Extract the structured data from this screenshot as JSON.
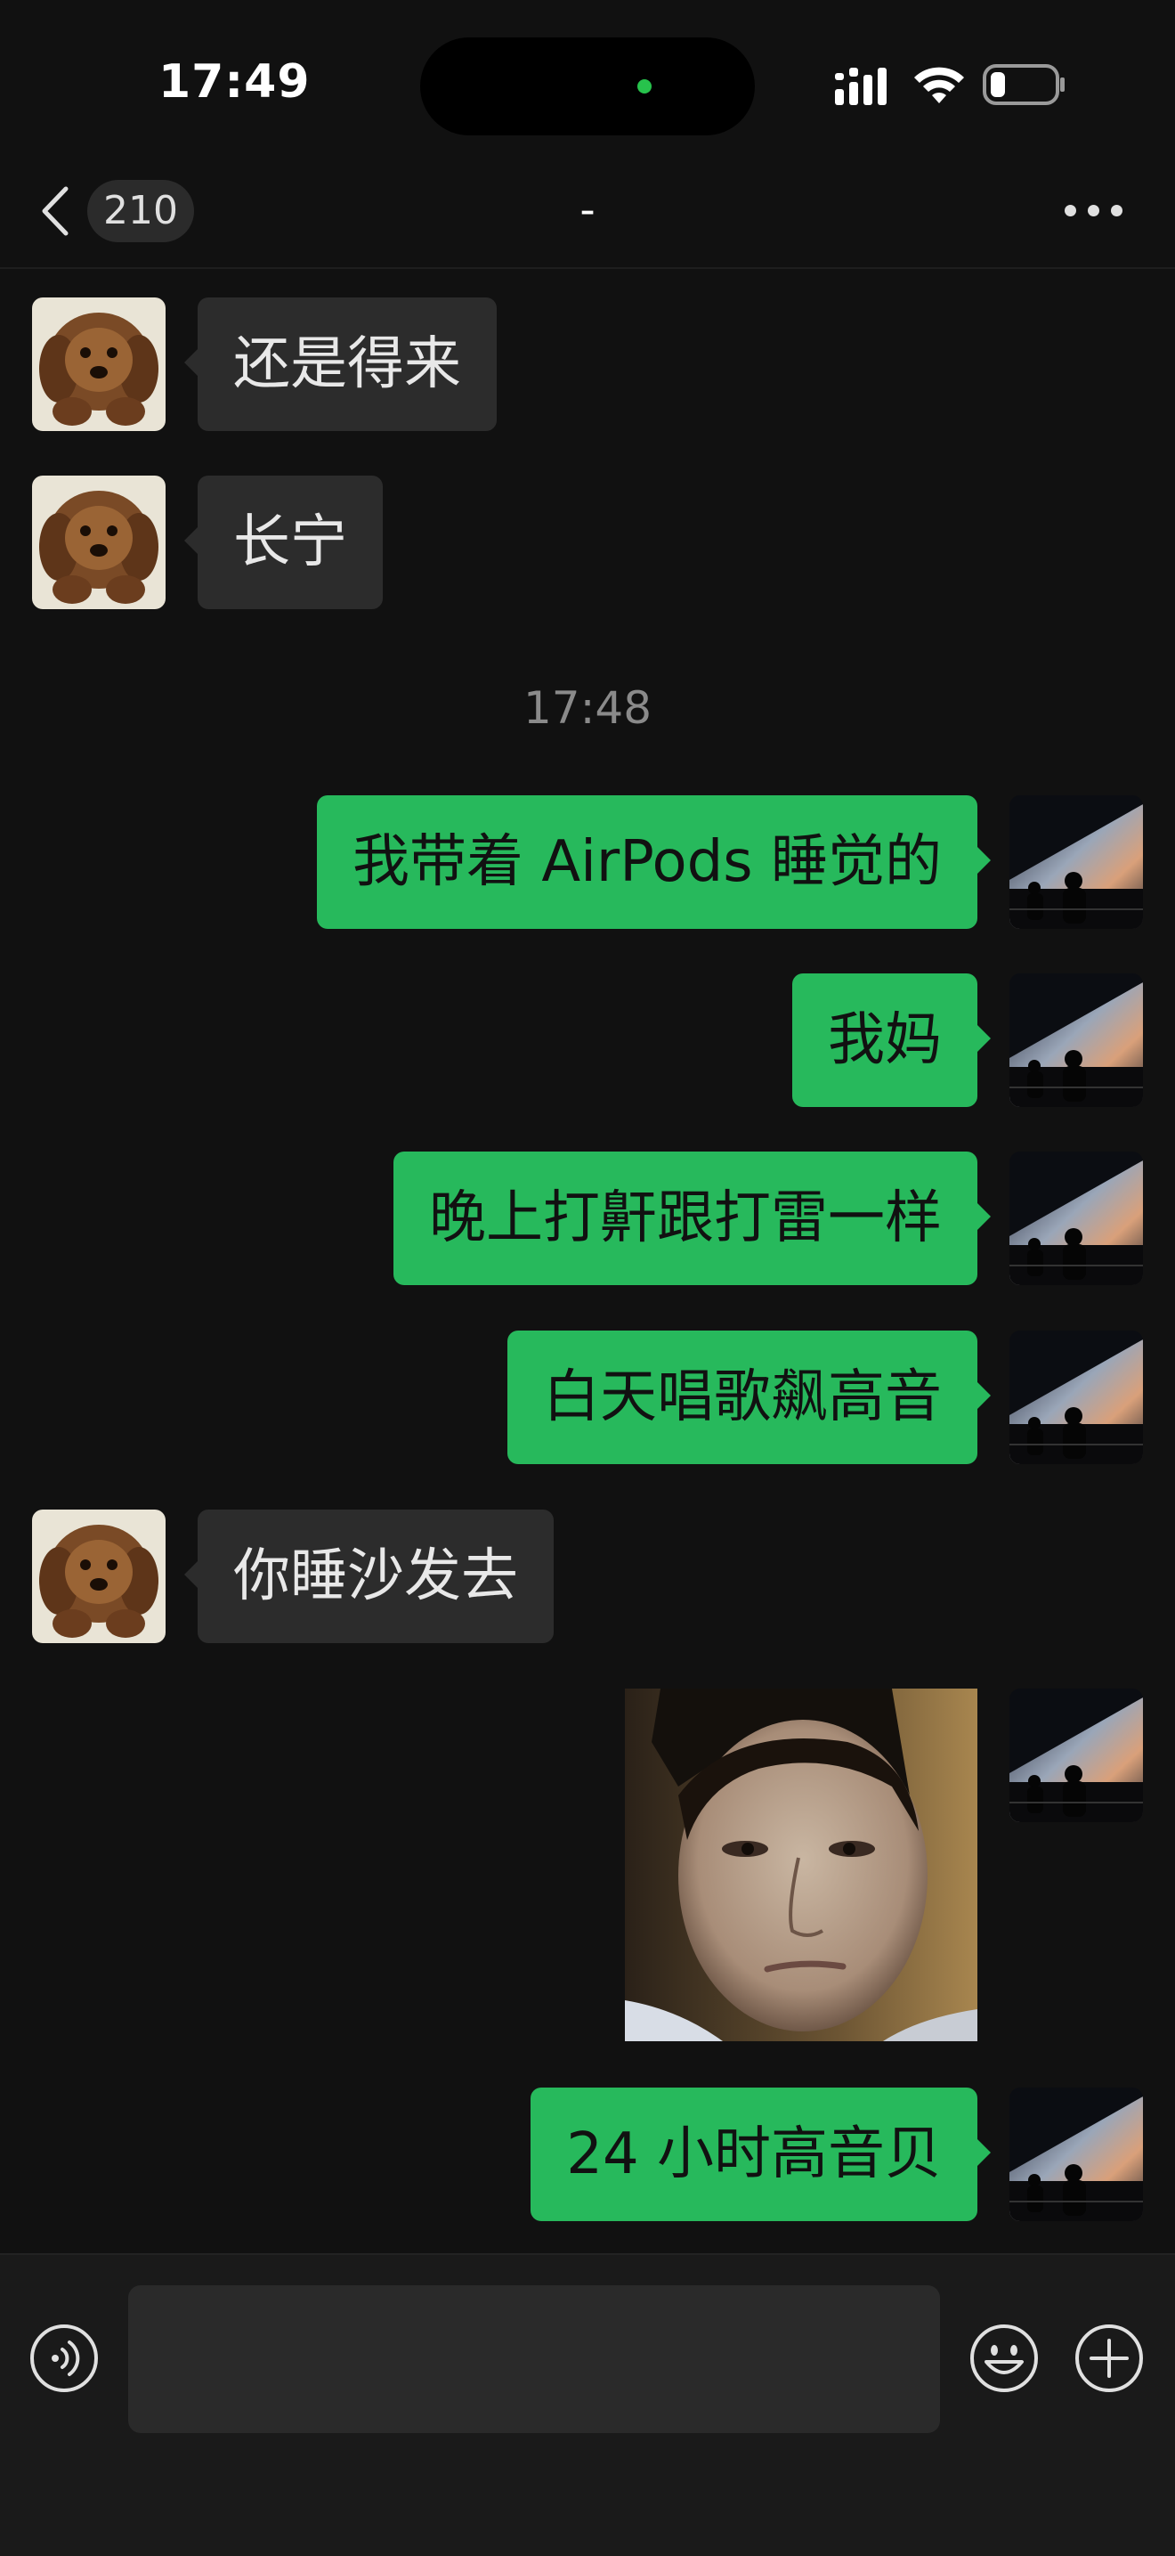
{
  "status_bar": {
    "time": "17:49",
    "icons": [
      "signal-icon",
      "wifi-icon",
      "battery-icon"
    ]
  },
  "nav": {
    "back_icon": "chevron-left-icon",
    "unread_count": "210",
    "title": "-",
    "more_icon": "more-dots-icon"
  },
  "messages": [
    {
      "direction": "in",
      "type": "text",
      "text": "还是得来"
    },
    {
      "direction": "in",
      "type": "text",
      "text": "长宁"
    },
    {
      "type": "timestamp",
      "text": "17:48"
    },
    {
      "direction": "out",
      "type": "text",
      "text": "我带着 AirPods 睡觉的"
    },
    {
      "direction": "out",
      "type": "text",
      "text": "我妈"
    },
    {
      "direction": "out",
      "type": "text",
      "text": "晚上打鼾跟打雷一样"
    },
    {
      "direction": "out",
      "type": "text",
      "text": "白天唱歌飙高音"
    },
    {
      "direction": "in",
      "type": "text",
      "text": "你睡沙发去"
    },
    {
      "direction": "out",
      "type": "image",
      "image": "portrait-photo"
    },
    {
      "direction": "out",
      "type": "text",
      "text": "24 小时高音贝"
    }
  ],
  "input_bar": {
    "voice_icon": "voice-icon",
    "input_value": "",
    "emoji_icon": "emoji-icon",
    "plus_icon": "plus-icon"
  },
  "colors": {
    "background": "#111111",
    "incoming_bubble": "#2c2c2c",
    "outgoing_bubble": "#27b95c",
    "input_bar": "#1a1a1a"
  }
}
